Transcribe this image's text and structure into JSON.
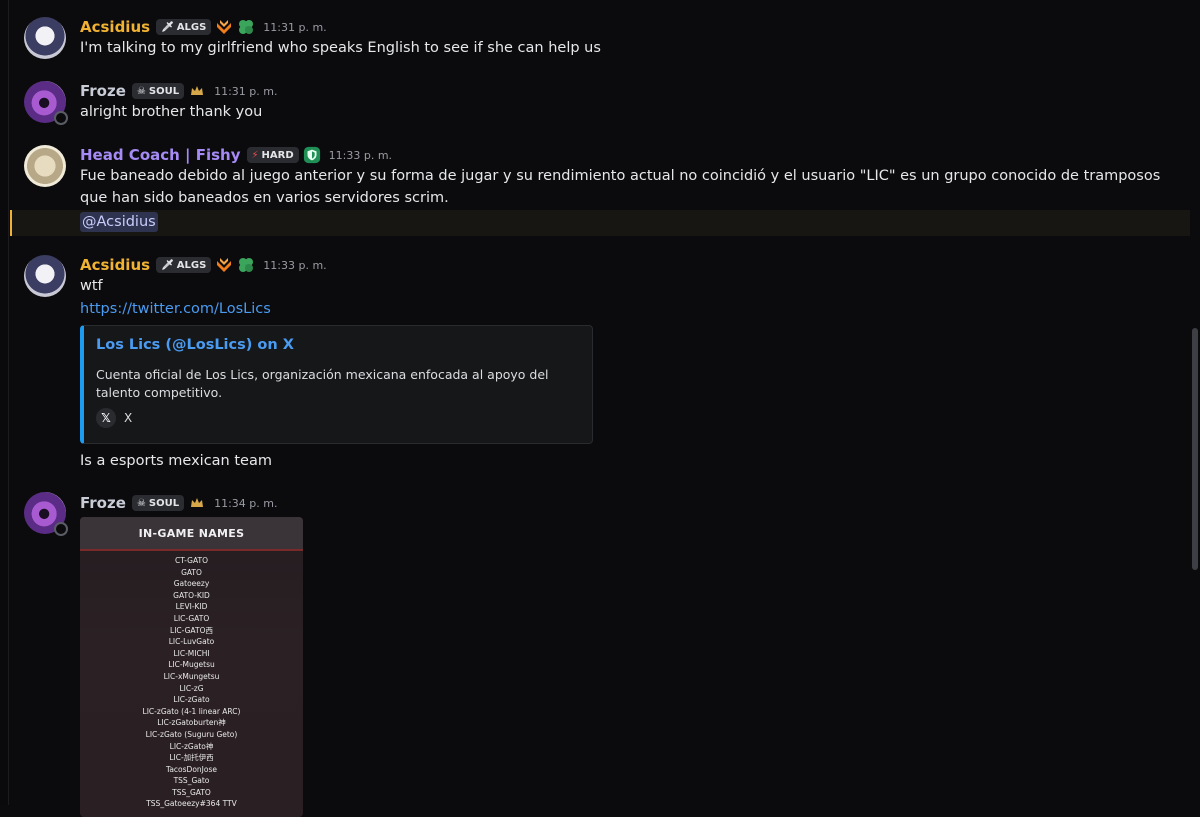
{
  "messages": [
    {
      "user": "Acsidius",
      "tag": "ALGS",
      "time": "11:31 p. m.",
      "text": "I'm talking to my girlfriend who speaks English to see if she can help us"
    },
    {
      "user": "Froze",
      "tag": "SOUL",
      "time": "11:31 p. m.",
      "text": "alright brother thank you"
    },
    {
      "user": "Head Coach | Fishy",
      "tag": "HARD",
      "time": "11:33 p. m.",
      "text": "Fue baneado debido al juego anterior y su forma de jugar y su rendimiento actual no coincidió y el usuario \"LIC\" es un grupo conocido de tramposos que han sido baneados en varios servidores scrim.",
      "mention": "@Acsidius"
    },
    {
      "user": "Acsidius",
      "tag": "ALGS",
      "time": "11:33 p. m.",
      "text": "wtf",
      "link": "https://twitter.com/LosLics",
      "embed": {
        "title": "Los Lics (@LosLics) on X",
        "description": "Cuenta oficial de Los Lics, organización mexicana enfocada al apoyo del talento competitivo.",
        "footer": "X"
      },
      "text2": "Is a esports mexican team"
    },
    {
      "user": "Froze",
      "tag": "SOUL",
      "time": "11:34 p. m.",
      "image": {
        "title": "IN-GAME NAMES",
        "names": [
          "CT-GATO",
          "GATO",
          "Gatoeezy",
          "GATO-KID",
          "LEVI-KID",
          "LIC-GATO",
          "LIC-GATO西",
          "LIC-LuvGato",
          "LIC-MICHI",
          "LIC-Mugetsu",
          "LIC-xMungetsu",
          "LIC-zG",
          "LIC-zGato",
          "LIC-zGato (4-1 linear ARC)",
          "LIC-zGatoburten神",
          "LIC-zGato (Suguru Geto)",
          "LIC-zGato神",
          "LIC-加托伊西",
          "TacosDonJose",
          "TSS_Gato",
          "TSS_GATO",
          "TSS_Gatoeezy#364 TTV"
        ]
      }
    }
  ],
  "colors": {
    "background": "#0b0b0d",
    "acsidius": "#f0b232",
    "fishy": "#a68bf7",
    "link": "#4a9bf2",
    "embed_accent": "#1d9bf0"
  },
  "icons": [
    "sword-icon",
    "skull-icon",
    "lightning-icon",
    "chevron-rank-icon",
    "clover-badge-icon",
    "crown-icon",
    "shield-badge-icon",
    "x-logo-icon"
  ]
}
